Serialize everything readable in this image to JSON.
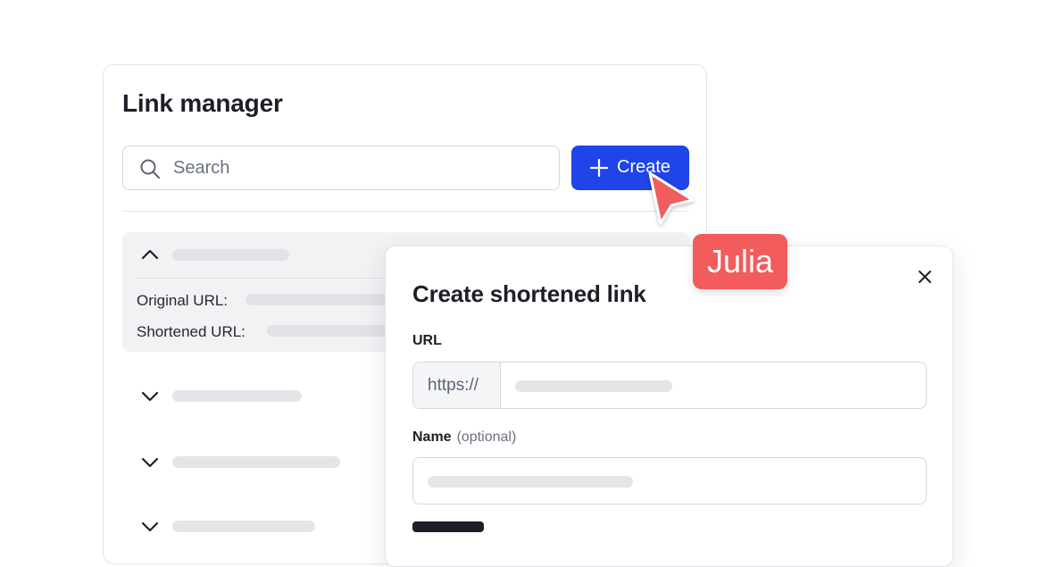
{
  "link_manager": {
    "title": "Link manager",
    "search": {
      "placeholder": "Search",
      "icon": "search-icon"
    },
    "create_button": {
      "label": "Create",
      "icon": "plus-icon",
      "color": "#1f44e8"
    },
    "expanded_row": {
      "original_url_label": "Original URL:",
      "shortened_url_label": "Shortened URL:"
    }
  },
  "modal": {
    "title": "Create shortened link",
    "url_label": "URL",
    "url_prefix": "https://",
    "name_label": "Name",
    "name_optional": "(optional)"
  },
  "collaborator": {
    "name": "Julia",
    "color": "#f25c5c"
  }
}
